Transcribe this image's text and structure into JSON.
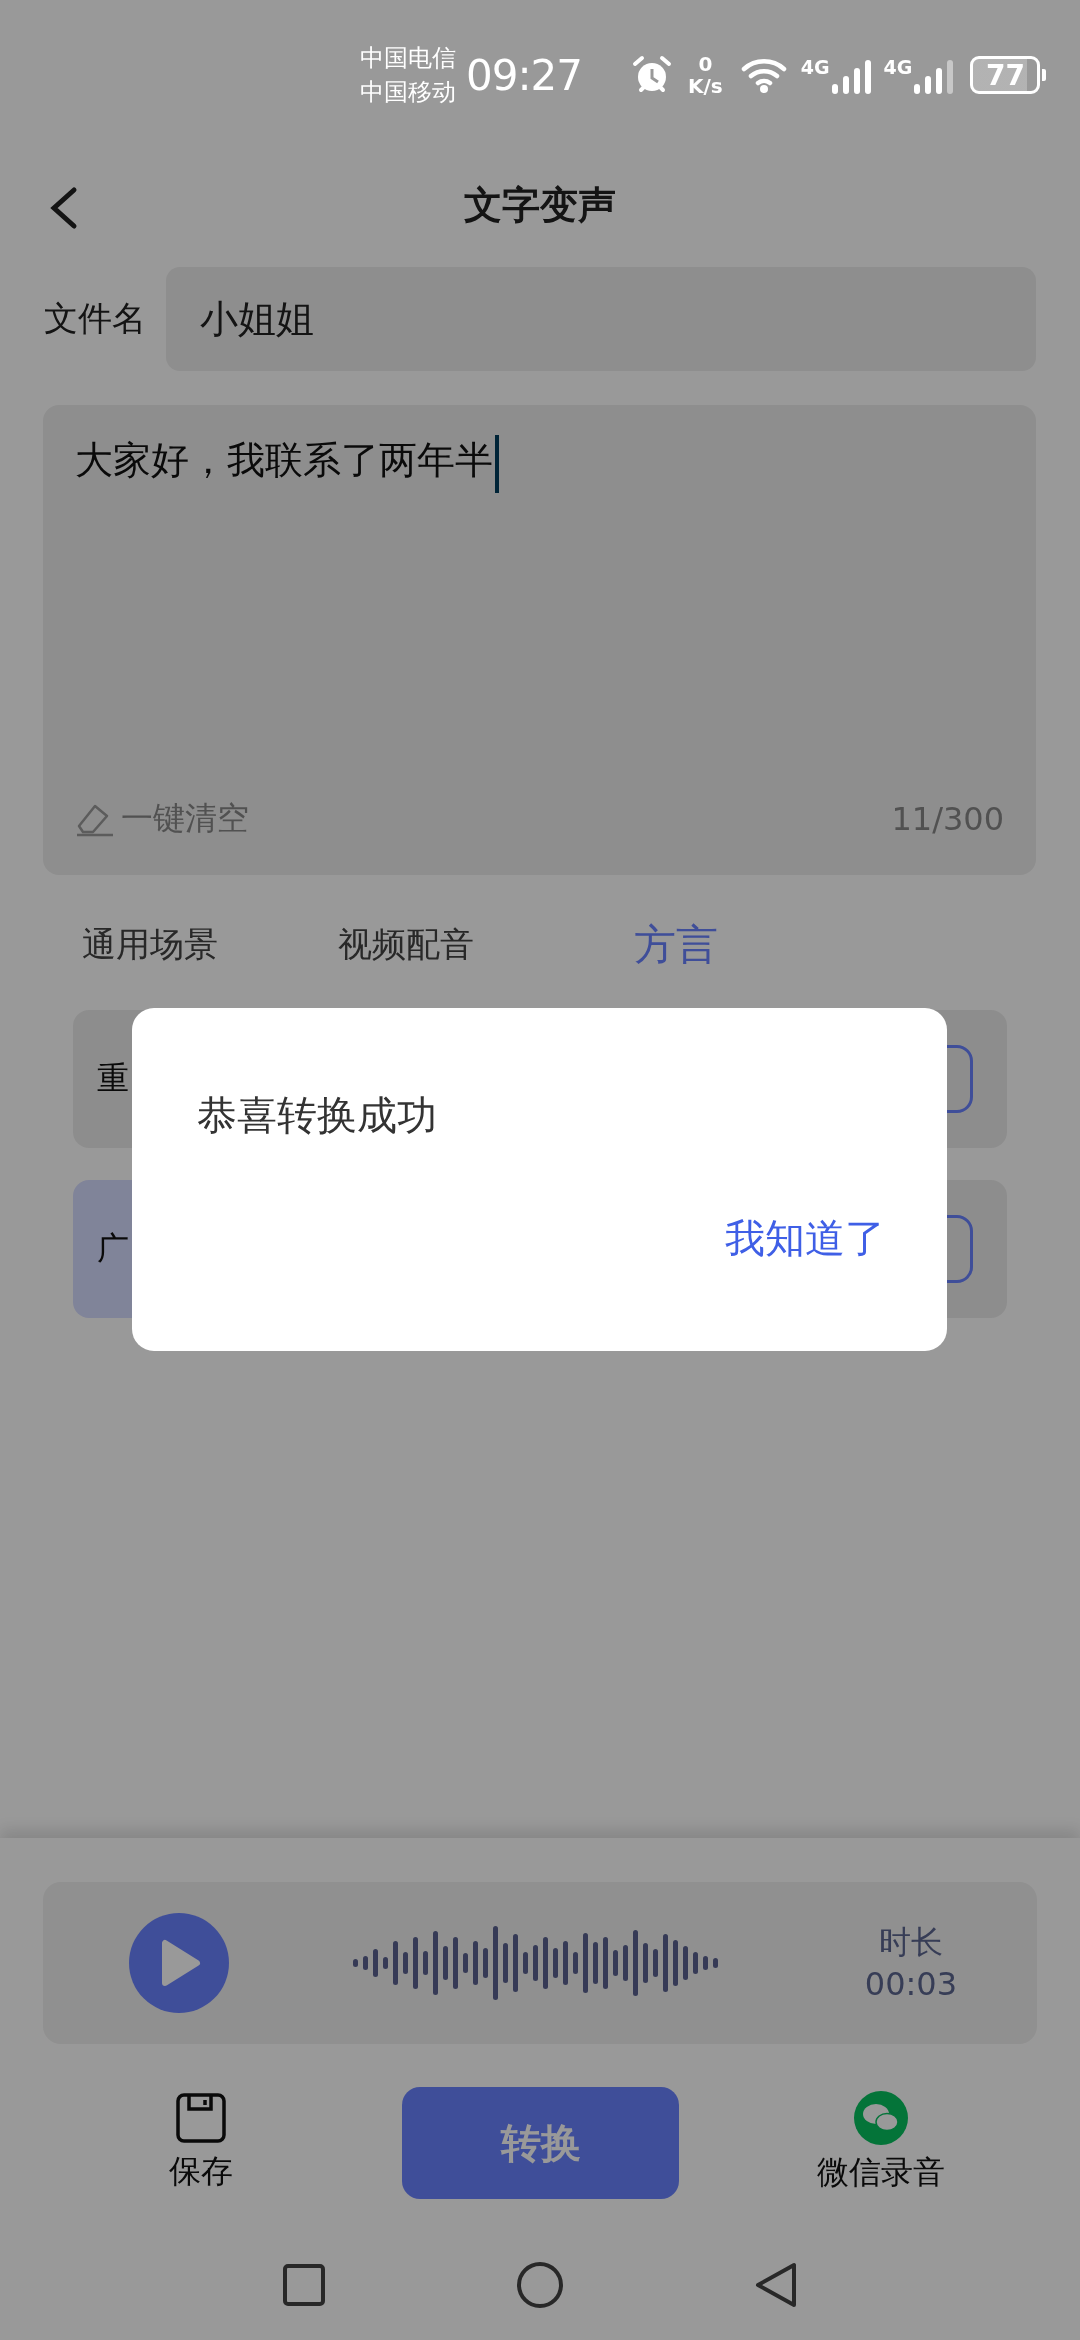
{
  "status_bar": {
    "carriers": [
      "中国电信",
      "中国移动"
    ],
    "time": "09:27",
    "net_speed": {
      "value": "0",
      "unit": "K/s"
    },
    "networks": [
      {
        "label": "4G"
      },
      {
        "label": "4G"
      }
    ],
    "battery": "77"
  },
  "header": {
    "title": "文字变声"
  },
  "file_name": {
    "label": "文件名",
    "value": "小姐姐"
  },
  "text_input": {
    "value": "大家好，我联系了两年半",
    "clear_label": "一键清空",
    "count": "11/300"
  },
  "tabs": [
    {
      "label": "通用场景",
      "selected": false
    },
    {
      "label": "视频配音",
      "selected": false
    },
    {
      "label": "方言",
      "selected": true
    }
  ],
  "voice_cards": [
    {
      "name": "重",
      "selected": false
    },
    {
      "selected": false
    },
    {
      "name": "广",
      "selected": true
    },
    {
      "selected": false
    }
  ],
  "player": {
    "duration_label": "时长",
    "duration": "00:03"
  },
  "actions": {
    "save": "保存",
    "convert": "转换",
    "wechat": "微信录音"
  },
  "dialog": {
    "message": "恭喜转换成功",
    "button": "我知道了"
  }
}
